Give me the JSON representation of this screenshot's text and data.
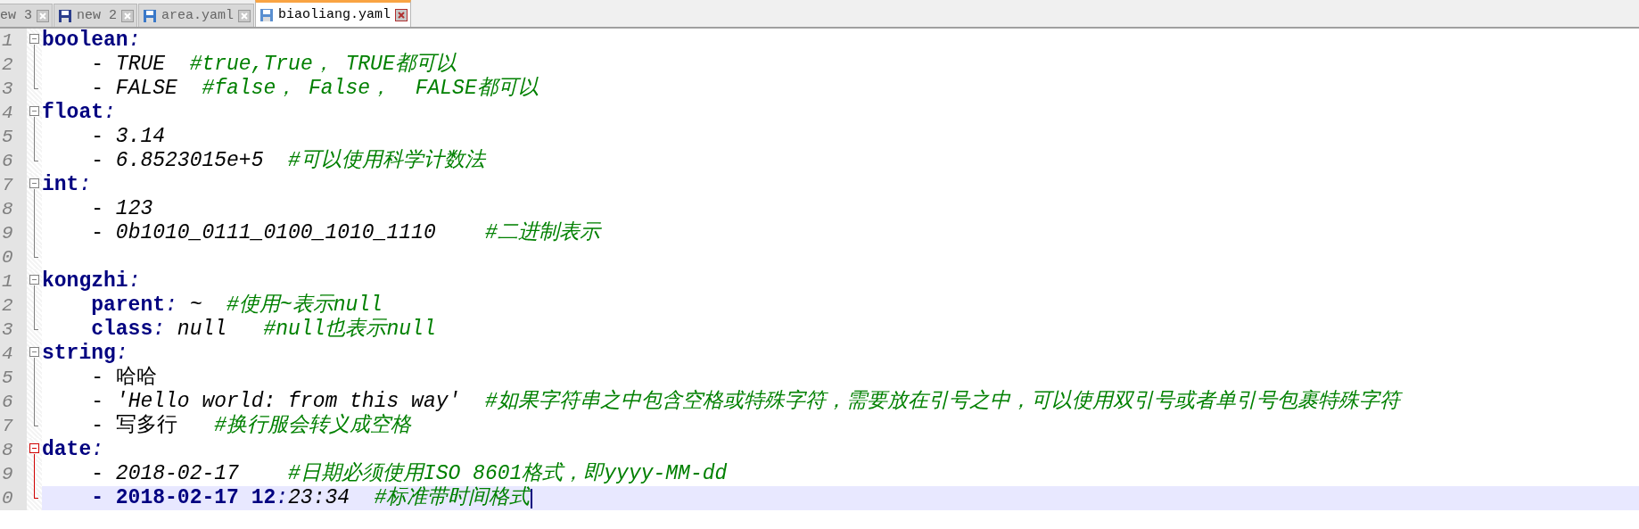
{
  "tabs": [
    {
      "label": "ew 3",
      "selected": false,
      "icon": false
    },
    {
      "label": "new 2",
      "selected": false,
      "icon": true
    },
    {
      "label": "area.yaml",
      "selected": false,
      "icon": true
    },
    {
      "label": "biaoliang.yaml",
      "selected": true,
      "icon": true
    }
  ],
  "editor": {
    "lines": [
      {
        "number": "1",
        "fold": {
          "kind": "start",
          "highlighted": false
        },
        "current": false,
        "segments": [
          {
            "kind": "key",
            "text": "boolean"
          },
          {
            "kind": "colon",
            "text": ":"
          }
        ]
      },
      {
        "number": "2",
        "fold": {
          "kind": "middle",
          "highlighted": false
        },
        "current": false,
        "segments": [
          {
            "kind": "plain",
            "text": "    - "
          },
          {
            "kind": "value",
            "text": "TRUE  "
          },
          {
            "kind": "comment",
            "text": "#true,True， TRUE都可以"
          }
        ]
      },
      {
        "number": "3",
        "fold": {
          "kind": "end",
          "highlighted": false
        },
        "current": false,
        "segments": [
          {
            "kind": "plain",
            "text": "    - "
          },
          {
            "kind": "value",
            "text": "FALSE  "
          },
          {
            "kind": "comment",
            "text": "#false， False，  FALSE都可以"
          }
        ]
      },
      {
        "number": "4",
        "fold": {
          "kind": "start",
          "highlighted": false
        },
        "current": false,
        "segments": [
          {
            "kind": "key",
            "text": "float"
          },
          {
            "kind": "colon",
            "text": ":"
          }
        ]
      },
      {
        "number": "5",
        "fold": {
          "kind": "middle",
          "highlighted": false
        },
        "current": false,
        "segments": [
          {
            "kind": "plain",
            "text": "    - "
          },
          {
            "kind": "value",
            "text": "3.14"
          }
        ]
      },
      {
        "number": "6",
        "fold": {
          "kind": "end",
          "highlighted": false
        },
        "current": false,
        "segments": [
          {
            "kind": "plain",
            "text": "    - "
          },
          {
            "kind": "value",
            "text": "6.8523015e+5  "
          },
          {
            "kind": "comment",
            "text": "#可以使用科学计数法"
          }
        ]
      },
      {
        "number": "7",
        "fold": {
          "kind": "start",
          "highlighted": false
        },
        "current": false,
        "segments": [
          {
            "kind": "key",
            "text": "int"
          },
          {
            "kind": "colon",
            "text": ":"
          }
        ]
      },
      {
        "number": "8",
        "fold": {
          "kind": "middle",
          "highlighted": false
        },
        "current": false,
        "segments": [
          {
            "kind": "plain",
            "text": "    - "
          },
          {
            "kind": "value",
            "text": "123"
          }
        ]
      },
      {
        "number": "9",
        "fold": {
          "kind": "middle",
          "highlighted": false
        },
        "current": false,
        "segments": [
          {
            "kind": "plain",
            "text": "    - "
          },
          {
            "kind": "value",
            "text": "0b1010_0111_0100_1010_1110    "
          },
          {
            "kind": "comment",
            "text": "#二进制表示"
          }
        ]
      },
      {
        "number": "0",
        "fold": {
          "kind": "end",
          "highlighted": false
        },
        "current": false
      },
      {
        "number": "1",
        "fold": {
          "kind": "start",
          "highlighted": false
        },
        "current": false,
        "segments": [
          {
            "kind": "key",
            "text": "kongzhi"
          },
          {
            "kind": "colon",
            "text": ":"
          }
        ]
      },
      {
        "number": "2",
        "fold": {
          "kind": "middle",
          "highlighted": false
        },
        "current": false,
        "segments": [
          {
            "kind": "key",
            "text": "    parent"
          },
          {
            "kind": "colon",
            "text": ":"
          },
          {
            "kind": "value",
            "text": " ~  "
          },
          {
            "kind": "comment",
            "text": "#使用~表示null"
          }
        ]
      },
      {
        "number": "3",
        "fold": {
          "kind": "end",
          "highlighted": false
        },
        "current": false,
        "segments": [
          {
            "kind": "key",
            "text": "    class"
          },
          {
            "kind": "colon",
            "text": ":"
          },
          {
            "kind": "value",
            "text": " null   "
          },
          {
            "kind": "comment",
            "text": "#null也表示null"
          }
        ]
      },
      {
        "number": "4",
        "fold": {
          "kind": "start",
          "highlighted": false
        },
        "current": false,
        "segments": [
          {
            "kind": "key",
            "text": "string"
          },
          {
            "kind": "colon",
            "text": ":"
          }
        ]
      },
      {
        "number": "5",
        "fold": {
          "kind": "middle",
          "highlighted": false
        },
        "current": false,
        "segments": [
          {
            "kind": "plain",
            "text": "    - 哈哈"
          }
        ]
      },
      {
        "number": "6",
        "fold": {
          "kind": "middle",
          "highlighted": false
        },
        "current": false,
        "segments": [
          {
            "kind": "plain",
            "text": "    - "
          },
          {
            "kind": "value",
            "text": "'Hello world: from this way'  "
          },
          {
            "kind": "comment",
            "text": "#如果字符串之中包含空格或特殊字符，需要放在引号之中，可以使用双引号或者单引号包裹特殊字符"
          }
        ]
      },
      {
        "number": "7",
        "fold": {
          "kind": "end",
          "highlighted": false
        },
        "current": false,
        "segments": [
          {
            "kind": "plain",
            "text": "    - 写多行   "
          },
          {
            "kind": "comment",
            "text": "#换行服会转义成空格"
          }
        ]
      },
      {
        "number": "8",
        "fold": {
          "kind": "start",
          "highlighted": true
        },
        "current": false,
        "segments": [
          {
            "kind": "key",
            "text": "date"
          },
          {
            "kind": "colon",
            "text": ":"
          }
        ]
      },
      {
        "number": "9",
        "fold": {
          "kind": "middle",
          "highlighted": true
        },
        "current": false,
        "segments": [
          {
            "kind": "plain",
            "text": "    - "
          },
          {
            "kind": "value",
            "text": "2018-02-17    "
          },
          {
            "kind": "comment",
            "text": "#日期必须使用ISO 8601格式，即yyyy-MM-dd"
          }
        ]
      },
      {
        "number": "0",
        "fold": {
          "kind": "end",
          "highlighted": true
        },
        "current": true,
        "segments": [
          {
            "kind": "key",
            "text": "    - 2018-02-17 12"
          },
          {
            "kind": "colon",
            "text": ":"
          },
          {
            "kind": "value",
            "text": "23:34  "
          },
          {
            "kind": "comment",
            "text": "#标准带时间格式"
          }
        ]
      }
    ]
  }
}
